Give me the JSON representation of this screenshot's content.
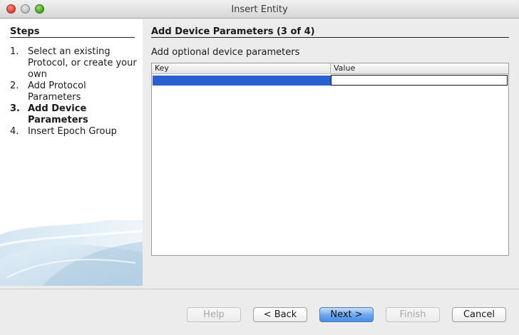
{
  "window": {
    "title": "Insert Entity"
  },
  "steps": {
    "heading": "Steps",
    "items": [
      {
        "num": "1.",
        "label": "Select an existing Protocol, or create your own"
      },
      {
        "num": "2.",
        "label": "Add Protocol Parameters"
      },
      {
        "num": "3.",
        "label": "Add Device Parameters"
      },
      {
        "num": "4.",
        "label": "Insert Epoch Group"
      }
    ],
    "active_index": 2
  },
  "content": {
    "title": "Add Device Parameters (3 of 4)",
    "description": "Add optional device parameters"
  },
  "table": {
    "columns": [
      "Key",
      "Value"
    ],
    "rows": [
      {
        "key": "",
        "value": ""
      }
    ]
  },
  "buttons": {
    "help": "Help",
    "back": "< Back",
    "next": "Next >",
    "finish": "Finish",
    "cancel": "Cancel"
  },
  "colors": {
    "selection": "#2a5fd0",
    "primary_button": "#6aa6ee"
  }
}
